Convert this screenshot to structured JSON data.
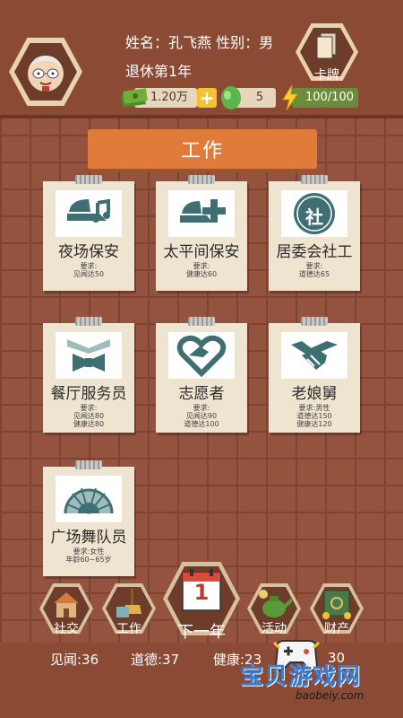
{
  "header": {
    "name_line": "姓名：孔飞燕  性别：男",
    "retire_line": "退休第1年",
    "card_label": "卡牌",
    "money": "1.20万",
    "plus": "+",
    "gems": "5",
    "health": "100/100"
  },
  "section": {
    "title": "工作"
  },
  "jobs": [
    {
      "title": "夜场保安",
      "req": "要求:\n见闻达50",
      "icon": "guard-cap-icon"
    },
    {
      "title": "太平间保安",
      "req": "要求:\n健康达60",
      "icon": "guard-cap-plus-icon"
    },
    {
      "title": "居委会社工",
      "req": "要求:\n道德达65",
      "icon": "community-badge-icon",
      "badge_char": "社"
    },
    {
      "title": "餐厅服务员",
      "req": "要求:\n见闻达80\n健康达80",
      "icon": "bowtie-icon"
    },
    {
      "title": "志愿者",
      "req": "要求:\n见闻达90\n道德达100",
      "icon": "heart-hand-icon"
    },
    {
      "title": "老娘舅",
      "req": "要求:男性\n道德达150\n健康达120",
      "icon": "handshake-icon"
    },
    {
      "title": "广场舞队员",
      "req": "要求:女性\n年龄60~65岁",
      "icon": "fan-icon"
    }
  ],
  "nav": {
    "social": "社交",
    "work": "工作",
    "next_year": "下一年",
    "calendar_day": "1",
    "activity": "活动",
    "assets": "财产"
  },
  "stats": {
    "knowledge": "见闻:36",
    "morality": "道德:37",
    "health": "健康:23",
    "extra": "30"
  },
  "watermark": {
    "text": "宝贝游戏网",
    "url": "baobeiy.com"
  }
}
